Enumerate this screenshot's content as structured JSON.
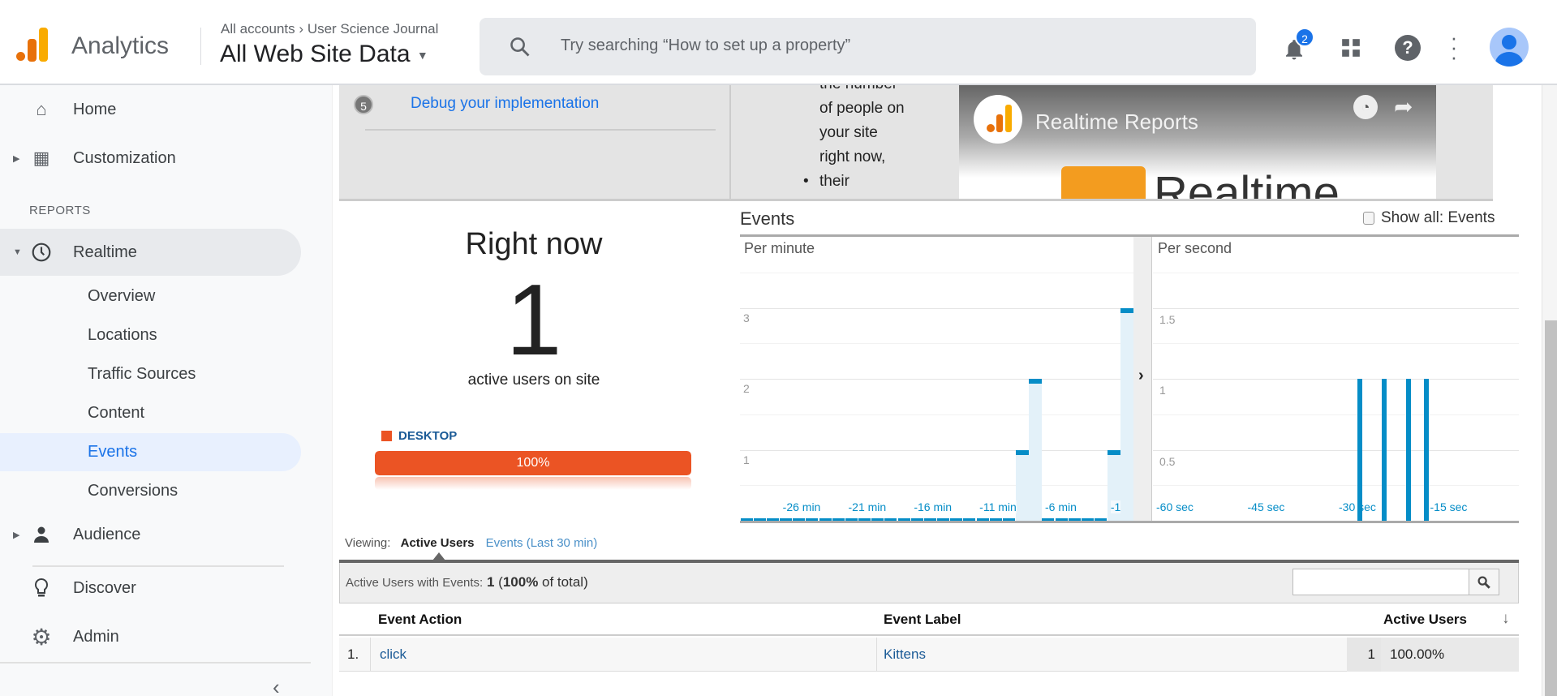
{
  "header": {
    "app_name": "Analytics",
    "breadcrumb": {
      "account": "All accounts",
      "separator": "›",
      "property": "User Science Journal"
    },
    "view": "All Web Site Data",
    "search_placeholder": "Try searching “How to set up a property”",
    "notification_count": "2",
    "icons": [
      "search-icon",
      "bell-icon",
      "apps-grid-icon",
      "help-icon",
      "more-vert-icon",
      "avatar-icon"
    ]
  },
  "sidebar": {
    "items": [
      {
        "label": "Home",
        "icon": "home-icon"
      },
      {
        "label": "Customization",
        "icon": "dashboard-plus-icon"
      }
    ],
    "section_label": "REPORTS",
    "realtime": {
      "label": "Realtime",
      "icon": "clock-icon",
      "children": [
        "Overview",
        "Locations",
        "Traffic Sources",
        "Content",
        "Events",
        "Conversions"
      ],
      "active": "Events"
    },
    "audience": {
      "label": "Audience",
      "icon": "person-icon"
    },
    "bottom": [
      {
        "label": "Discover",
        "icon": "lightbulb-icon"
      },
      {
        "label": "Admin",
        "icon": "gear-icon"
      }
    ],
    "collapse_icon": "chevron-left-icon"
  },
  "help_panel": {
    "step_number": "5",
    "step_link": "Debug your implementation",
    "bullet_lines": [
      "the number",
      "of people on",
      "your site",
      "right now,",
      "their"
    ],
    "video_title": "Realtime Reports",
    "video_thumb_text": "Realtime"
  },
  "right_now": {
    "title": "Right now",
    "count": "1",
    "subtitle": "active users on site",
    "device_label": "DESKTOP",
    "device_percent_label": "100%",
    "device_percent": 100,
    "device_color": "#eb5424"
  },
  "events_panel": {
    "title": "Events",
    "show_all_label": "Show all: Events",
    "show_all_checked": false
  },
  "chart_data": [
    {
      "type": "bar",
      "title": "Per minute",
      "x_unit": "min",
      "x": [
        -30,
        -29,
        -28,
        -27,
        -26,
        -25,
        -24,
        -23,
        -22,
        -21,
        -20,
        -19,
        -18,
        -17,
        -16,
        -15,
        -14,
        -13,
        -12,
        -11,
        -10,
        -9,
        -8,
        -7,
        -6,
        -5,
        -4,
        -3,
        -2,
        -1
      ],
      "values": [
        0,
        0,
        0,
        0,
        0,
        0,
        0,
        0,
        0,
        0,
        0,
        0,
        0,
        0,
        0,
        0,
        0,
        0,
        0,
        0,
        0,
        1,
        2,
        0,
        0,
        0,
        0,
        0,
        1,
        3
      ],
      "xtick_labels": [
        "-26 min",
        "-21 min",
        "-16 min",
        "-11 min",
        "-6 min",
        "-1"
      ],
      "ytick_labels": [
        "1",
        "2",
        "3"
      ],
      "ylim": [
        0,
        3.5
      ],
      "grid": true,
      "color": "#058dc7"
    },
    {
      "type": "bar",
      "title": "Per second",
      "x_unit": "sec",
      "x": [
        -27,
        -23,
        -19,
        -16
      ],
      "values": [
        1,
        1,
        1,
        1
      ],
      "xlim": [
        -60,
        0
      ],
      "xtick_labels": [
        "-60 sec",
        "-45 sec",
        "-30 sec",
        "-15 sec"
      ],
      "ytick_labels": [
        "0.5",
        "1",
        "1.5"
      ],
      "ylim": [
        0,
        1.75
      ],
      "grid": true,
      "color": "#058dc7"
    }
  ],
  "viewing": {
    "label": "Viewing:",
    "tabs": [
      "Active Users",
      "Events (Last 30 min)"
    ],
    "active": "Active Users"
  },
  "summary": {
    "label": "Active Users with Events:",
    "value": "1",
    "pct_open": "(",
    "pct": "100%",
    "pct_close": " of total)"
  },
  "table": {
    "columns": [
      "Event Action",
      "Event Label",
      "Active Users"
    ],
    "sort_icon": "arrow-down-icon",
    "rows": [
      {
        "index": "1.",
        "action": "click",
        "label": "Kittens",
        "users": "1",
        "percent": "100.00%"
      }
    ]
  }
}
